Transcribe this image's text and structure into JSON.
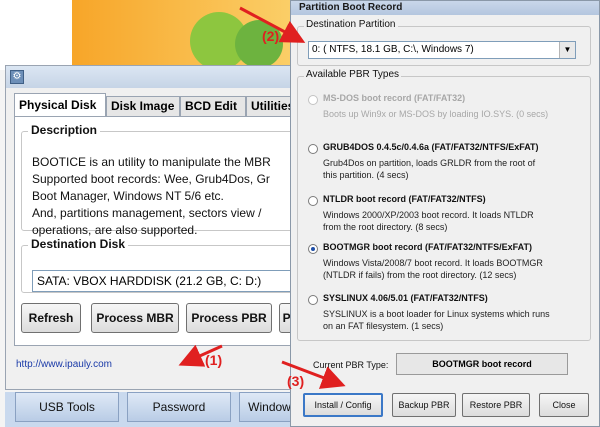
{
  "main_window": {
    "tabs": [
      "Physical Disk",
      "Disk Image",
      "BCD Edit",
      "Utilities"
    ],
    "description_title": "Description",
    "description_text": "BOOTICE is an utility to manipulate the MBR\nSupported boot records: Wee, Grub4Dos, Gr\nBoot Manager, Windows NT 5/6 etc.\nAnd, partitions management, sectors view /\noperations, are also supported.",
    "destination_disk_title": "Destination Disk",
    "destination_disk_value": "SATA: VBOX HARDDISK (21.2 GB, C: D:)",
    "buttons": [
      "Refresh",
      "Process MBR",
      "Process PBR",
      "Pa"
    ],
    "website": "http://www.ipauly.com",
    "bottom_tabs": [
      "USB Tools",
      "Password",
      "Window"
    ]
  },
  "pbr_dialog": {
    "title": "Partition Boot Record",
    "destination_title": "Destination Partition",
    "destination_value": "0: ( NTFS,  18.1 GB, C:\\, Windows 7)",
    "available_title": "Available PBR Types",
    "options": [
      {
        "title": "MS-DOS boot record (FAT/FAT32)",
        "desc": "Boots up Win9x or MS-DOS by loading IO.SYS. (0 secs)",
        "disabled": true,
        "checked": false
      },
      {
        "title": "GRUB4DOS 0.4.5c/0.4.6a (FAT/FAT32/NTFS/ExFAT)",
        "desc": "Grub4Dos on partition, loads GRLDR from the root of\nthis partition. (4 secs)",
        "disabled": false,
        "checked": false
      },
      {
        "title": "NTLDR boot record (FAT/FAT32/NTFS)",
        "desc": "Windows 2000/XP/2003 boot record. It loads NTLDR\nfrom the root directory. (8 secs)",
        "disabled": false,
        "checked": false
      },
      {
        "title": "BOOTMGR boot record (FAT/FAT32/NTFS/ExFAT)",
        "desc": "Windows Vista/2008/7 boot record. It loads BOOTMGR\n(NTLDR if fails) from the root directory. (12 secs)",
        "disabled": false,
        "checked": true
      },
      {
        "title": "SYSLINUX 4.06/5.01 (FAT/FAT32/NTFS)",
        "desc": "SYSLINUX is a boot loader for Linux systems which runs\non an FAT filesystem. (1 secs)",
        "disabled": false,
        "checked": false
      }
    ],
    "current_type_label": "Current PBR Type:",
    "current_type_value": "BOOTMGR boot record",
    "buttons": [
      "Install / Config",
      "Backup PBR",
      "Restore PBR",
      "Close"
    ]
  },
  "annotations": [
    "(1)",
    "(2)",
    "(3)"
  ],
  "colors": {
    "annotation": "#e02020",
    "link": "#1a3aa8",
    "accent_orange": "#f7a528",
    "accent_green": "#8dc63f"
  }
}
